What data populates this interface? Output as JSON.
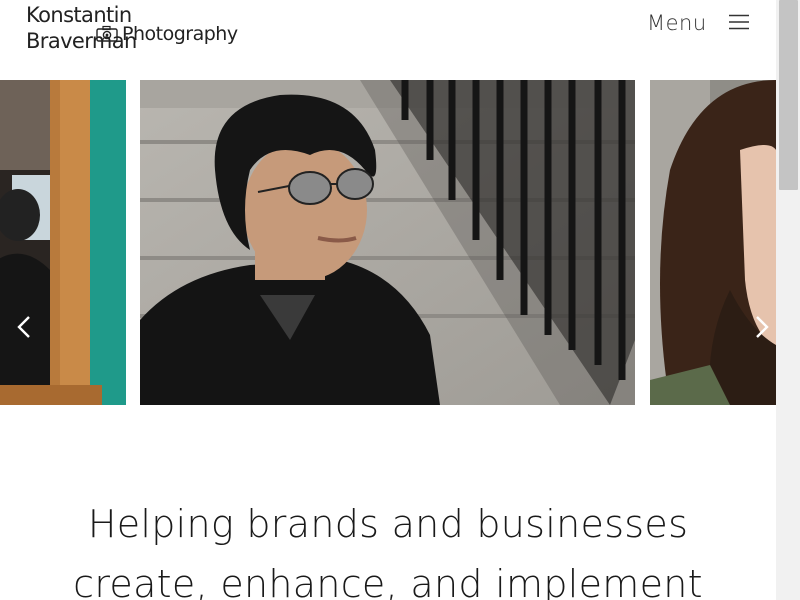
{
  "header": {
    "logo": {
      "line1": "Konstantin Braverman",
      "line2": "Photography"
    },
    "menu_label": "Menu",
    "icons": {
      "camera": "camera-icon",
      "menu": "hamburger-icon"
    }
  },
  "carousel": {
    "prev_icon": "chevron-left-icon",
    "next_icon": "chevron-right-icon",
    "slides": [
      "slide-prev",
      "slide-main",
      "slide-next"
    ]
  },
  "hero": {
    "line1": "Helping brands and businesses",
    "line2": "create, enhance, and implement"
  },
  "colors": {
    "text": "#1a1a1a",
    "background": "#ffffff",
    "scrollbar_track": "#f1f1f1",
    "scrollbar_thumb": "#c4c4c4"
  }
}
